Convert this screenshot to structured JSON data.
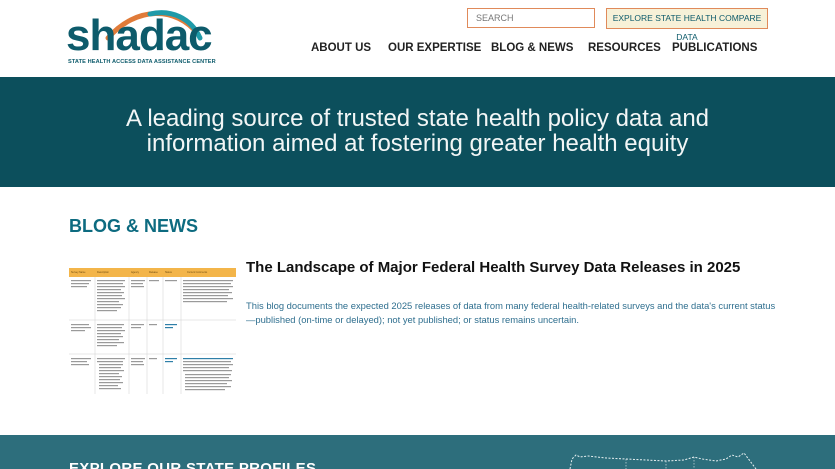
{
  "logo": {
    "wordmark": "shadac",
    "tagline": "STATE HEALTH ACCESS DATA ASSISTANCE CENTER",
    "colors": {
      "primary": "#0d5b6b",
      "arc_orange": "#e07b39",
      "arc_teal": "#1f9aa8"
    }
  },
  "header": {
    "search_placeholder": "SEARCH",
    "explore_button": "EXPLORE STATE HEALTH COMPARE DATA",
    "nav": [
      "ABOUT US",
      "OUR EXPERTISE",
      "BLOG & NEWS",
      "RESOURCES",
      "PUBLICATIONS"
    ]
  },
  "hero": {
    "line1": "A leading source of trusted state health policy data and",
    "line2": "information aimed at fostering greater health equity",
    "background": "#0c4f5c"
  },
  "blog": {
    "section_title": "BLOG & NEWS",
    "post": {
      "title": "The Landscape of Major Federal Health Survey Data Releases in 2025",
      "excerpt": "This blog documents the expected 2025 releases of data from many federal health-related surveys and the data's current status—published (on-time or delayed); not yet published; or status remains uncertain.",
      "thumbnail_icon": "survey-table-thumbnail"
    }
  },
  "band": {
    "title": "EXPLORE OUR STATE PROFILES",
    "background": "#2d6e7c",
    "map_icon": "us-map-icon"
  }
}
